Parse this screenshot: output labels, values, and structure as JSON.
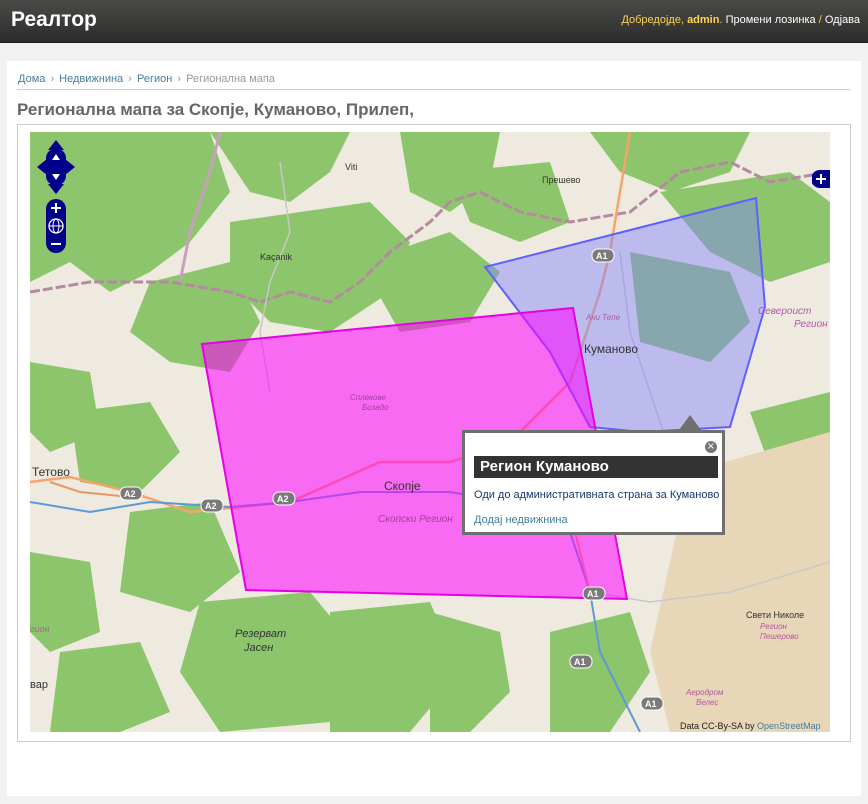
{
  "header": {
    "brand": "Реалтор",
    "welcome": "Добредојде,",
    "username": "admin",
    "change_password": "Промени лозинка",
    "separator": "/",
    "logout": "Одјава"
  },
  "breadcrumb": {
    "home": "Дома",
    "properties": "Недвижнина",
    "region": "Регион",
    "current": "Регионална мапа",
    "sep": "›"
  },
  "page": {
    "title": "Регионална мапа за Скопје, Куманово, Прилеп,"
  },
  "map": {
    "labels": {
      "viti": "Viti",
      "presevo": "Прешево",
      "kacanik": "Kaçanik",
      "kumanovo": "Куманово",
      "aci_tepe": "Ачи Тепе",
      "skopje": "Скопје",
      "skopski_region": "Скопски Регион",
      "tetovo": "Тетово",
      "reserve_line1": "Резерват",
      "reserve_line2": "Јасен",
      "sveti_nikole": "Свети Николе",
      "region_pink1": "Регион",
      "region_pink2": "Пешерово",
      "severoist1": "Североист",
      "severoist2": "Регион",
      "airport1": "Аеродром",
      "airport2": "Велес",
      "pink_region_left": "гион",
      "left_edge": "вар",
      "sredno": "Сплекове",
      "sredno2": "Бозадо",
      "road_a1_top": "A1",
      "road_a1_bottom": "A1",
      "road_a1_low": "A1",
      "road_a1_br": "A1",
      "road_a2_left": "A2",
      "road_a2_mid": "A2",
      "road_a2_center": "A2"
    },
    "colors": {
      "pink_fill": "#ff00ff",
      "blue_fill": "#8080ff",
      "forest": "#8dc56c",
      "background": "#eeeae0"
    }
  },
  "popup": {
    "close": "×",
    "title": "Регион Куманово",
    "admin_link": "Оди до административната страна за Куманово",
    "add_property": "Додај недвижнина"
  },
  "attribution": {
    "prefix": "Data CC-By-SA by",
    "link": "OpenStreetMap"
  }
}
